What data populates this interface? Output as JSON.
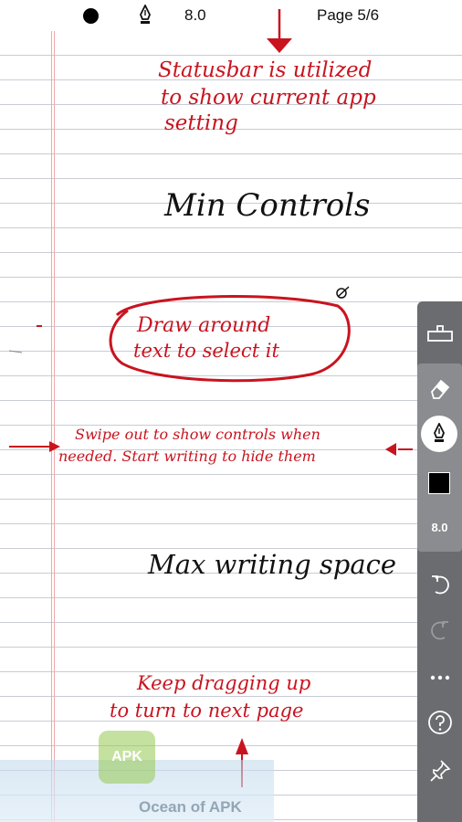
{
  "statusbar": {
    "pen_size": "8.0",
    "page": "Page 5/6"
  },
  "notes": {
    "statusbar_line1": "Statusbar is utilized",
    "statusbar_line2": "to show current app",
    "statusbar_line3": "setting",
    "min_controls": "Min Controls",
    "draw_line1": "Draw around",
    "draw_line2": "text to select it",
    "swipe_line1": "Swipe out to show controls when",
    "swipe_line2": "needed. Start writing to hide them",
    "max_writing": "Max writing space",
    "keep_line1": "Keep dragging up",
    "keep_line2": "to turn to next page"
  },
  "toolbar": {
    "size_value": "8.0",
    "ink_color": "#000000"
  },
  "watermark": {
    "badge": "APK",
    "text": "Ocean of APK"
  },
  "colors": {
    "ink_red": "#c8141f",
    "ink_black": "#111111",
    "toolbar_bg": "#6a6c6f",
    "toolbar_group_bg": "#8a8c8f",
    "rule_line": "#c9ccd6",
    "margin_line": "#f2a6aa"
  }
}
